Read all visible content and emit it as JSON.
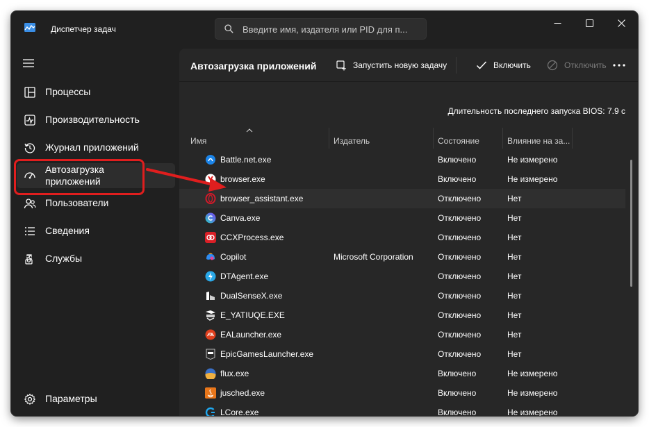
{
  "app": {
    "title": "Диспетчер задач"
  },
  "search": {
    "placeholder": "Введите имя, издателя или PID для п..."
  },
  "nav": {
    "items": [
      {
        "label": "Процессы",
        "icon": "processes-icon"
      },
      {
        "label": "Производительность",
        "icon": "performance-icon"
      },
      {
        "label": "Журнал приложений",
        "icon": "history-icon"
      },
      {
        "label": "Автозагрузка приложений",
        "icon": "startup-icon",
        "active": true
      },
      {
        "label": "Пользователи",
        "icon": "users-icon"
      },
      {
        "label": "Сведения",
        "icon": "details-icon"
      },
      {
        "label": "Службы",
        "icon": "services-icon"
      }
    ],
    "settings_label": "Параметры"
  },
  "toolbar": {
    "title": "Автозагрузка приложений",
    "run_task": "Запустить новую задачу",
    "enable": "Включить",
    "disable": "Отключить"
  },
  "bios_text": "Длительность последнего запуска BIOS: 7.9 с",
  "table": {
    "columns": [
      "Имя",
      "Издатель",
      "Состояние",
      "Влияние на за..."
    ],
    "rows": [
      {
        "name": "Battle.net.exe",
        "publisher": "",
        "state": "Включено",
        "impact": "Не измерено",
        "icon": "battlenet-icon"
      },
      {
        "name": "browser.exe",
        "publisher": "",
        "state": "Включено",
        "impact": "Не измерено",
        "icon": "yandex-browser-icon"
      },
      {
        "name": "browser_assistant.exe",
        "publisher": "",
        "state": "Отключено",
        "impact": "Нет",
        "icon": "opera-icon"
      },
      {
        "name": "Canva.exe",
        "publisher": "",
        "state": "Отключено",
        "impact": "Нет",
        "icon": "canva-icon"
      },
      {
        "name": "CCXProcess.exe",
        "publisher": "",
        "state": "Отключено",
        "impact": "Нет",
        "icon": "adobe-cc-icon"
      },
      {
        "name": "Copilot",
        "publisher": "Microsoft Corporation",
        "state": "Отключено",
        "impact": "Нет",
        "icon": "copilot-icon"
      },
      {
        "name": "DTAgent.exe",
        "publisher": "",
        "state": "Отключено",
        "impact": "Нет",
        "icon": "daemon-tools-icon"
      },
      {
        "name": "DualSenseX.exe",
        "publisher": "",
        "state": "Отключено",
        "impact": "Нет",
        "icon": "dualsensex-icon"
      },
      {
        "name": "E_YATIUQE.EXE",
        "publisher": "",
        "state": "Отключено",
        "impact": "Нет",
        "icon": "epson-icon"
      },
      {
        "name": "EALauncher.exe",
        "publisher": "",
        "state": "Отключено",
        "impact": "Нет",
        "icon": "ea-icon"
      },
      {
        "name": "EpicGamesLauncher.exe",
        "publisher": "",
        "state": "Отключено",
        "impact": "Нет",
        "icon": "epic-games-icon"
      },
      {
        "name": "flux.exe",
        "publisher": "",
        "state": "Включено",
        "impact": "Не измерено",
        "icon": "flux-icon"
      },
      {
        "name": "jusched.exe",
        "publisher": "",
        "state": "Включено",
        "impact": "Не измерено",
        "icon": "java-icon"
      },
      {
        "name": "LCore.exe",
        "publisher": "",
        "state": "Включено",
        "impact": "Не измерено",
        "icon": "logitech-icon"
      }
    ]
  },
  "colors": {
    "window_bg": "#202020",
    "content_bg": "#272727",
    "accent_red": "#e01e1e",
    "text": "#ffffff"
  }
}
